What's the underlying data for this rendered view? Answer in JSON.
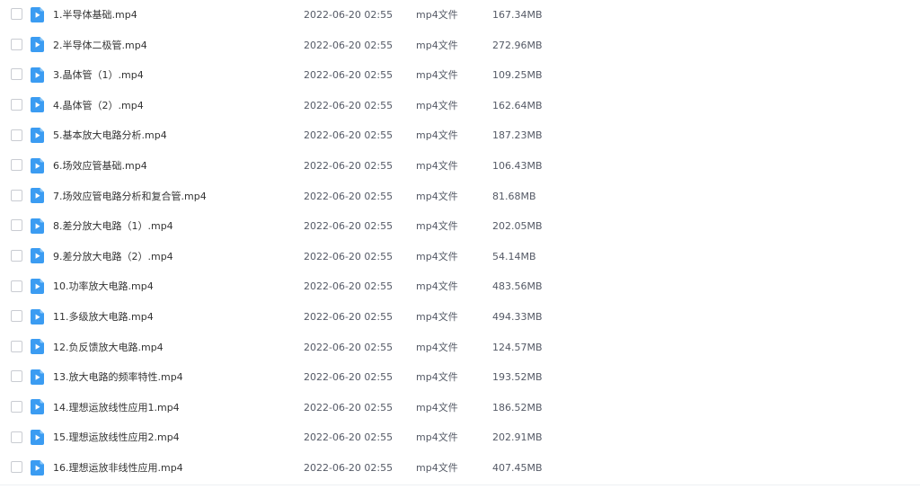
{
  "colors": {
    "icon_bg": "#3b9cf2",
    "icon_fold": "#8cc8f8",
    "icon_play": "#ffffff"
  },
  "files": [
    {
      "name": "1.半导体基础.mp4",
      "date": "2022-06-20 02:55",
      "type": "mp4文件",
      "size": "167.34MB"
    },
    {
      "name": "2.半导体二极管.mp4",
      "date": "2022-06-20 02:55",
      "type": "mp4文件",
      "size": "272.96MB"
    },
    {
      "name": "3.晶体管（1）.mp4",
      "date": "2022-06-20 02:55",
      "type": "mp4文件",
      "size": "109.25MB"
    },
    {
      "name": "4.晶体管（2）.mp4",
      "date": "2022-06-20 02:55",
      "type": "mp4文件",
      "size": "162.64MB"
    },
    {
      "name": "5.基本放大电路分析.mp4",
      "date": "2022-06-20 02:55",
      "type": "mp4文件",
      "size": "187.23MB"
    },
    {
      "name": "6.场效应管基础.mp4",
      "date": "2022-06-20 02:55",
      "type": "mp4文件",
      "size": "106.43MB"
    },
    {
      "name": "7.场效应管电路分析和复合管.mp4",
      "date": "2022-06-20 02:55",
      "type": "mp4文件",
      "size": "81.68MB"
    },
    {
      "name": "8.差分放大电路（1）.mp4",
      "date": "2022-06-20 02:55",
      "type": "mp4文件",
      "size": "202.05MB"
    },
    {
      "name": "9.差分放大电路（2）.mp4",
      "date": "2022-06-20 02:55",
      "type": "mp4文件",
      "size": "54.14MB"
    },
    {
      "name": "10.功率放大电路.mp4",
      "date": "2022-06-20 02:55",
      "type": "mp4文件",
      "size": "483.56MB"
    },
    {
      "name": "11.多级放大电路.mp4",
      "date": "2022-06-20 02:55",
      "type": "mp4文件",
      "size": "494.33MB"
    },
    {
      "name": "12.负反馈放大电路.mp4",
      "date": "2022-06-20 02:55",
      "type": "mp4文件",
      "size": "124.57MB"
    },
    {
      "name": "13.放大电路的频率特性.mp4",
      "date": "2022-06-20 02:55",
      "type": "mp4文件",
      "size": "193.52MB"
    },
    {
      "name": "14.理想运放线性应用1.mp4",
      "date": "2022-06-20 02:55",
      "type": "mp4文件",
      "size": "186.52MB"
    },
    {
      "name": "15.理想运放线性应用2.mp4",
      "date": "2022-06-20 02:55",
      "type": "mp4文件",
      "size": "202.91MB"
    },
    {
      "name": "16.理想运放非线性应用.mp4",
      "date": "2022-06-20 02:55",
      "type": "mp4文件",
      "size": "407.45MB"
    }
  ],
  "icons": {
    "row_checkbox": "checkbox-icon",
    "row_file": "video-file-icon"
  }
}
